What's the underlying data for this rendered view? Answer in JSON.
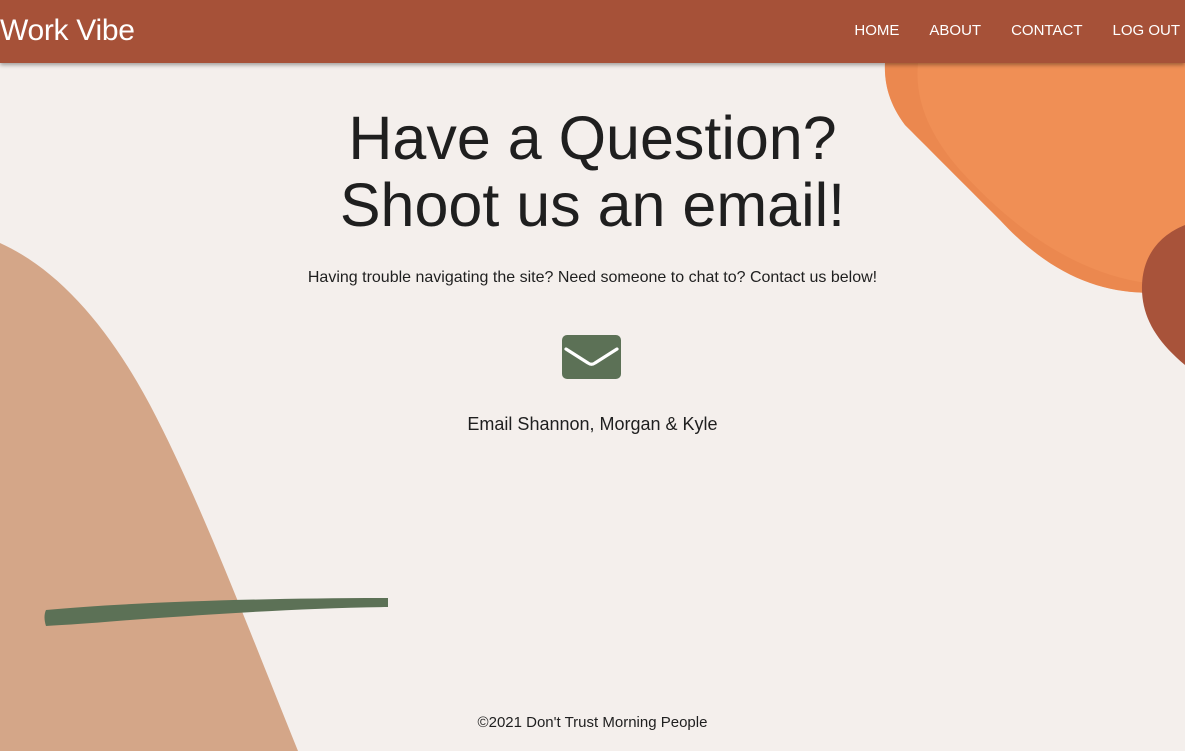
{
  "brand": {
    "name": "Work Vibe",
    "color": "#a65138"
  },
  "nav": {
    "items": [
      {
        "label": "HOME"
      },
      {
        "label": "ABOUT"
      },
      {
        "label": "CONTACT"
      },
      {
        "label": "LOG OUT"
      }
    ]
  },
  "main": {
    "heading_line1": "Have a Question?",
    "heading_line2": "Shoot us an email!",
    "subtitle": "Having trouble navigating the site? Need someone to chat to? Contact us below!",
    "email_icon": "envelope-icon",
    "email_label": "Email Shannon, Morgan & Kyle"
  },
  "footer": {
    "text": "©2021 Don't Trust Morning People"
  },
  "colors": {
    "background": "#f4efec",
    "navbar": "#a65138",
    "accent_orange": "#f08f55",
    "accent_tan": "#d4a688",
    "accent_rust": "#a8533a",
    "accent_green": "#5c7156",
    "text": "#1f1f1f"
  }
}
